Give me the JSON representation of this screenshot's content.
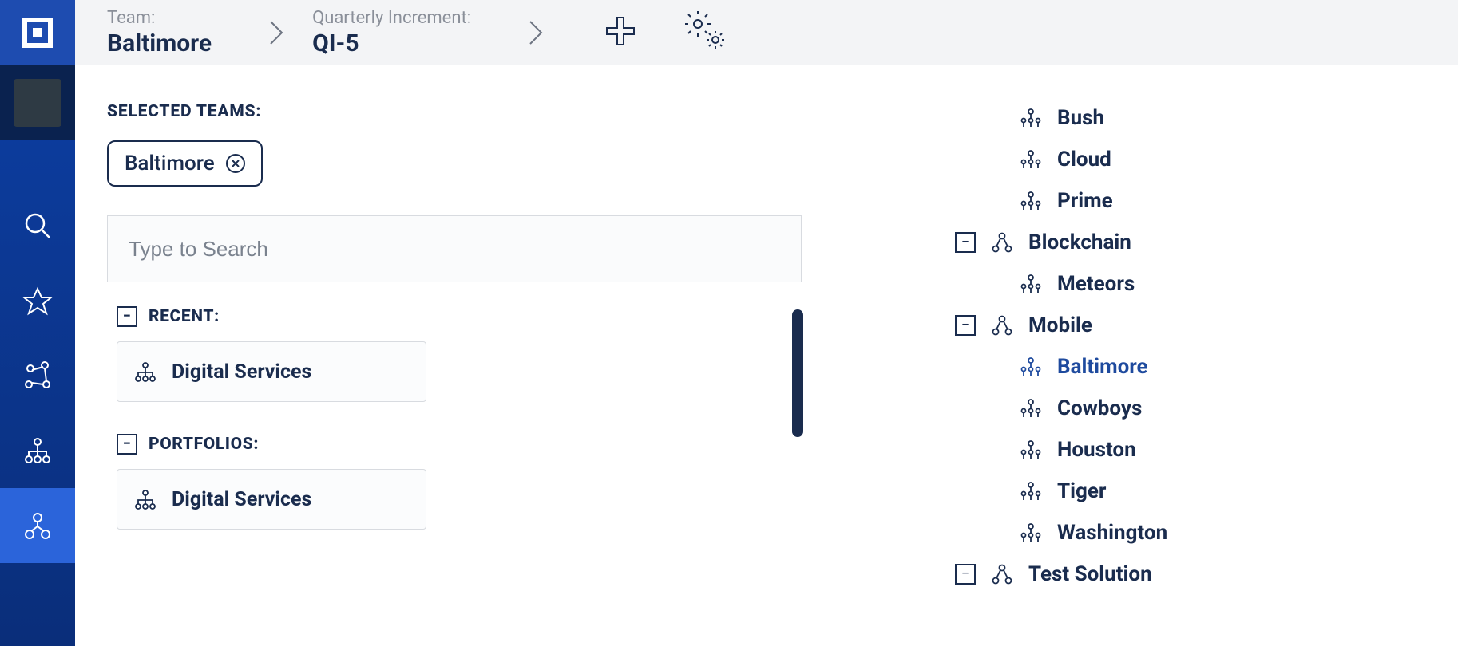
{
  "breadcrumb": {
    "team_label": "Team:",
    "team_value": "Baltimore",
    "qi_label": "Quarterly Increment:",
    "qi_value": "QI-5"
  },
  "selected_teams": {
    "title": "SELECTED TEAMS:",
    "chips": [
      {
        "name": "Baltimore"
      }
    ]
  },
  "search": {
    "placeholder": "Type to Search"
  },
  "groups": {
    "recent": {
      "title": "RECENT:",
      "items": [
        {
          "name": "Digital Services"
        }
      ]
    },
    "portfolios": {
      "title": "PORTFOLIOS:",
      "items": [
        {
          "name": "Digital Services"
        }
      ]
    }
  },
  "tree": {
    "orphan_teams": [
      {
        "name": "Bush"
      },
      {
        "name": "Cloud"
      },
      {
        "name": "Prime"
      }
    ],
    "solutions": [
      {
        "name": "Blockchain",
        "teams": [
          {
            "name": "Meteors"
          }
        ]
      },
      {
        "name": "Mobile",
        "teams": [
          {
            "name": "Baltimore",
            "selected": true
          },
          {
            "name": "Cowboys"
          },
          {
            "name": "Houston"
          },
          {
            "name": "Tiger"
          },
          {
            "name": "Washington"
          }
        ]
      },
      {
        "name": "Test Solution",
        "teams": []
      }
    ]
  }
}
